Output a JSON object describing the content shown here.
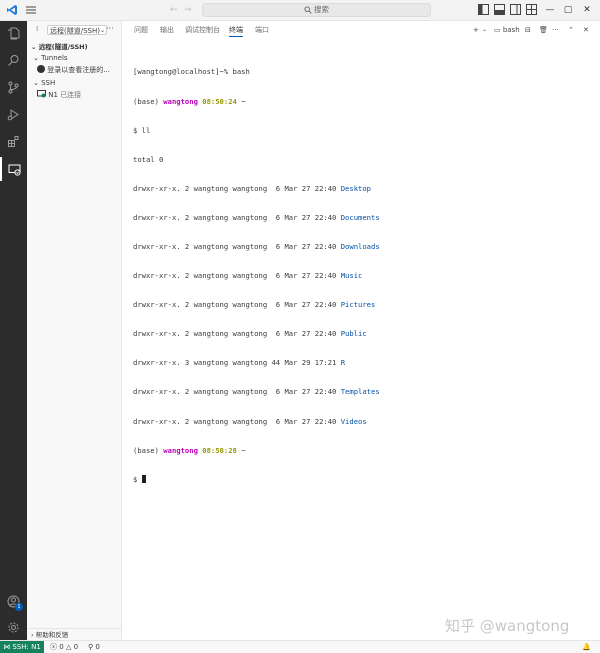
{
  "titlebar": {
    "search_label": "搜索"
  },
  "sidebar": {
    "view_select": "远程(隧道/SSH)",
    "section_title": "远程(隧道/SSH)",
    "tunnels_label": "Tunnels",
    "tunnels_signin": "登录以查看注册的...",
    "ssh_label": "SSH",
    "host_name": "N1",
    "host_status": "已连接",
    "bottom_label": "帮助和反馈"
  },
  "panel": {
    "tabs": [
      "问题",
      "输出",
      "调试控制台",
      "终端",
      "端口"
    ],
    "active_tab": "终端",
    "terminal_name": "bash"
  },
  "terminal": {
    "prompt_line": "[wangtong@localhost]~% bash",
    "base": "(base)",
    "user": "wangtong",
    "time1": "08:50:24",
    "tilde": "~",
    "command": "$ ll",
    "total": "total 0",
    "entries": [
      {
        "perm": "drwxr-xr-x. 2 wangtong wangtong  6 Mar 27 22:40 ",
        "name": "Desktop"
      },
      {
        "perm": "drwxr-xr-x. 2 wangtong wangtong  6 Mar 27 22:40 ",
        "name": "Documents"
      },
      {
        "perm": "drwxr-xr-x. 2 wangtong wangtong  6 Mar 27 22:40 ",
        "name": "Downloads"
      },
      {
        "perm": "drwxr-xr-x. 2 wangtong wangtong  6 Mar 27 22:40 ",
        "name": "Music"
      },
      {
        "perm": "drwxr-xr-x. 2 wangtong wangtong  6 Mar 27 22:40 ",
        "name": "Pictures"
      },
      {
        "perm": "drwxr-xr-x. 2 wangtong wangtong  6 Mar 27 22:40 ",
        "name": "Public"
      },
      {
        "perm": "drwxr-xr-x. 3 wangtong wangtong 44 Mar 29 17:21 ",
        "name": "R"
      },
      {
        "perm": "drwxr-xr-x. 2 wangtong wangtong  6 Mar 27 22:40 ",
        "name": "Templates"
      },
      {
        "perm": "drwxr-xr-x. 2 wangtong wangtong  6 Mar 27 22:40 ",
        "name": "Videos"
      }
    ],
    "time2": "08:50:28",
    "dollar": "$"
  },
  "watermark": "知乎 @wangtong",
  "statusbar": {
    "remote": "SSH: N1",
    "errors": "0",
    "warnings": "0",
    "ports": "0"
  },
  "colors": {
    "accent": "#005fb8",
    "remote_bg": "#16825d",
    "activity_bg": "#2c2c2c",
    "prompt_user": "#bc05bc",
    "prompt_time": "#949800",
    "dir_name": "#0451a5"
  }
}
